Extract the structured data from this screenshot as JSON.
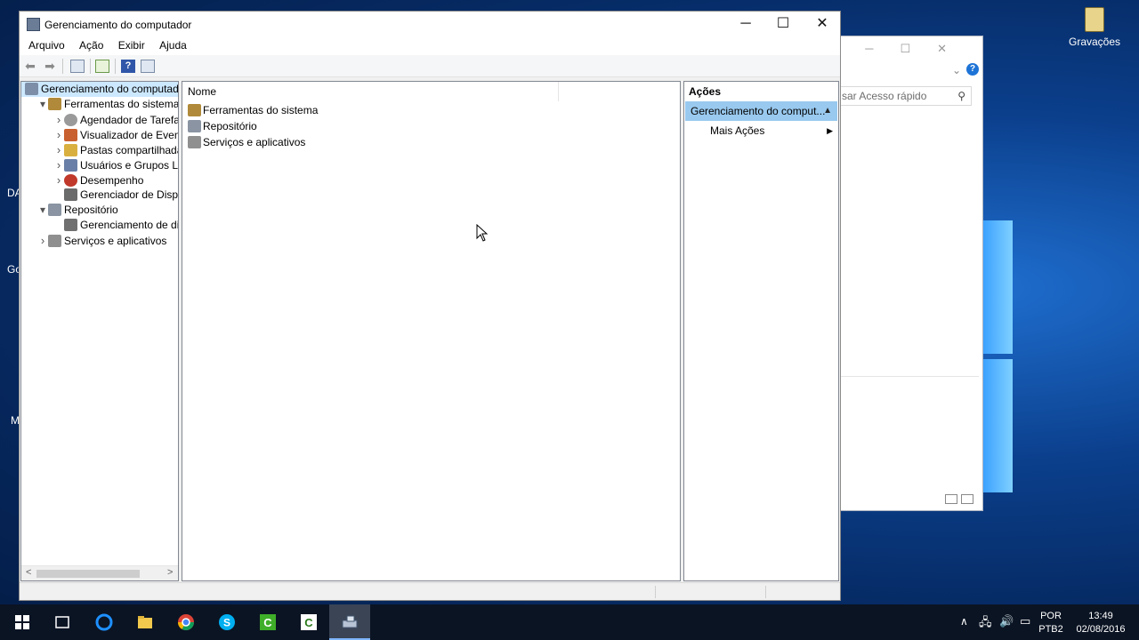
{
  "desktop": {
    "icon_label": "Gravações",
    "edge_texts": [
      "DA",
      "Go",
      "M"
    ]
  },
  "explorer": {
    "search_placeholder": "sar Acesso rápido"
  },
  "window": {
    "title": "Gerenciamento do computador",
    "menu": [
      "Arquivo",
      "Ação",
      "Exibir",
      "Ajuda"
    ],
    "tree": [
      {
        "label": "Gerenciamento do computado",
        "level": 0,
        "expander": "",
        "selected": true,
        "icon": "computer-management-icon"
      },
      {
        "label": "Ferramentas do sistema",
        "level": 1,
        "expander": "open",
        "icon": "system-tools-icon"
      },
      {
        "label": "Agendador de Tarefas",
        "level": 2,
        "expander": "closed",
        "icon": "clock-icon"
      },
      {
        "label": "Visualizador de Eventos",
        "level": 2,
        "expander": "closed",
        "icon": "event-viewer-icon"
      },
      {
        "label": "Pastas compartilhadas",
        "level": 2,
        "expander": "closed",
        "icon": "shared-folder-icon"
      },
      {
        "label": "Usuários e Grupos Loca",
        "level": 2,
        "expander": "closed",
        "icon": "users-icon"
      },
      {
        "label": "Desempenho",
        "level": 2,
        "expander": "closed",
        "icon": "performance-icon"
      },
      {
        "label": "Gerenciador de Disposit",
        "level": 2,
        "expander": "",
        "icon": "device-manager-icon"
      },
      {
        "label": "Repositório",
        "level": 1,
        "expander": "open",
        "icon": "storage-icon"
      },
      {
        "label": "Gerenciamento de disco",
        "level": 2,
        "expander": "",
        "icon": "disk-icon"
      },
      {
        "label": "Serviços e aplicativos",
        "level": 1,
        "expander": "closed",
        "icon": "services-icon"
      }
    ],
    "list_header": "Nome",
    "list_items": [
      {
        "label": "Ferramentas do sistema",
        "icon": "system-tools-icon"
      },
      {
        "label": "Repositório",
        "icon": "storage-icon"
      },
      {
        "label": "Serviços e aplicativos",
        "icon": "services-icon"
      }
    ],
    "actions": {
      "header": "Ações",
      "group": "Gerenciamento do comput...",
      "items": [
        "Mais Ações"
      ]
    }
  },
  "taskbar": {
    "apps": [
      "start",
      "task-view",
      "edge",
      "file-explorer",
      "chrome",
      "skype",
      "camtasia-green",
      "camtasia-white",
      "computer-management"
    ],
    "language_top": "POR",
    "language_bottom": "PTB2",
    "time": "13:49",
    "date": "02/08/2016"
  }
}
